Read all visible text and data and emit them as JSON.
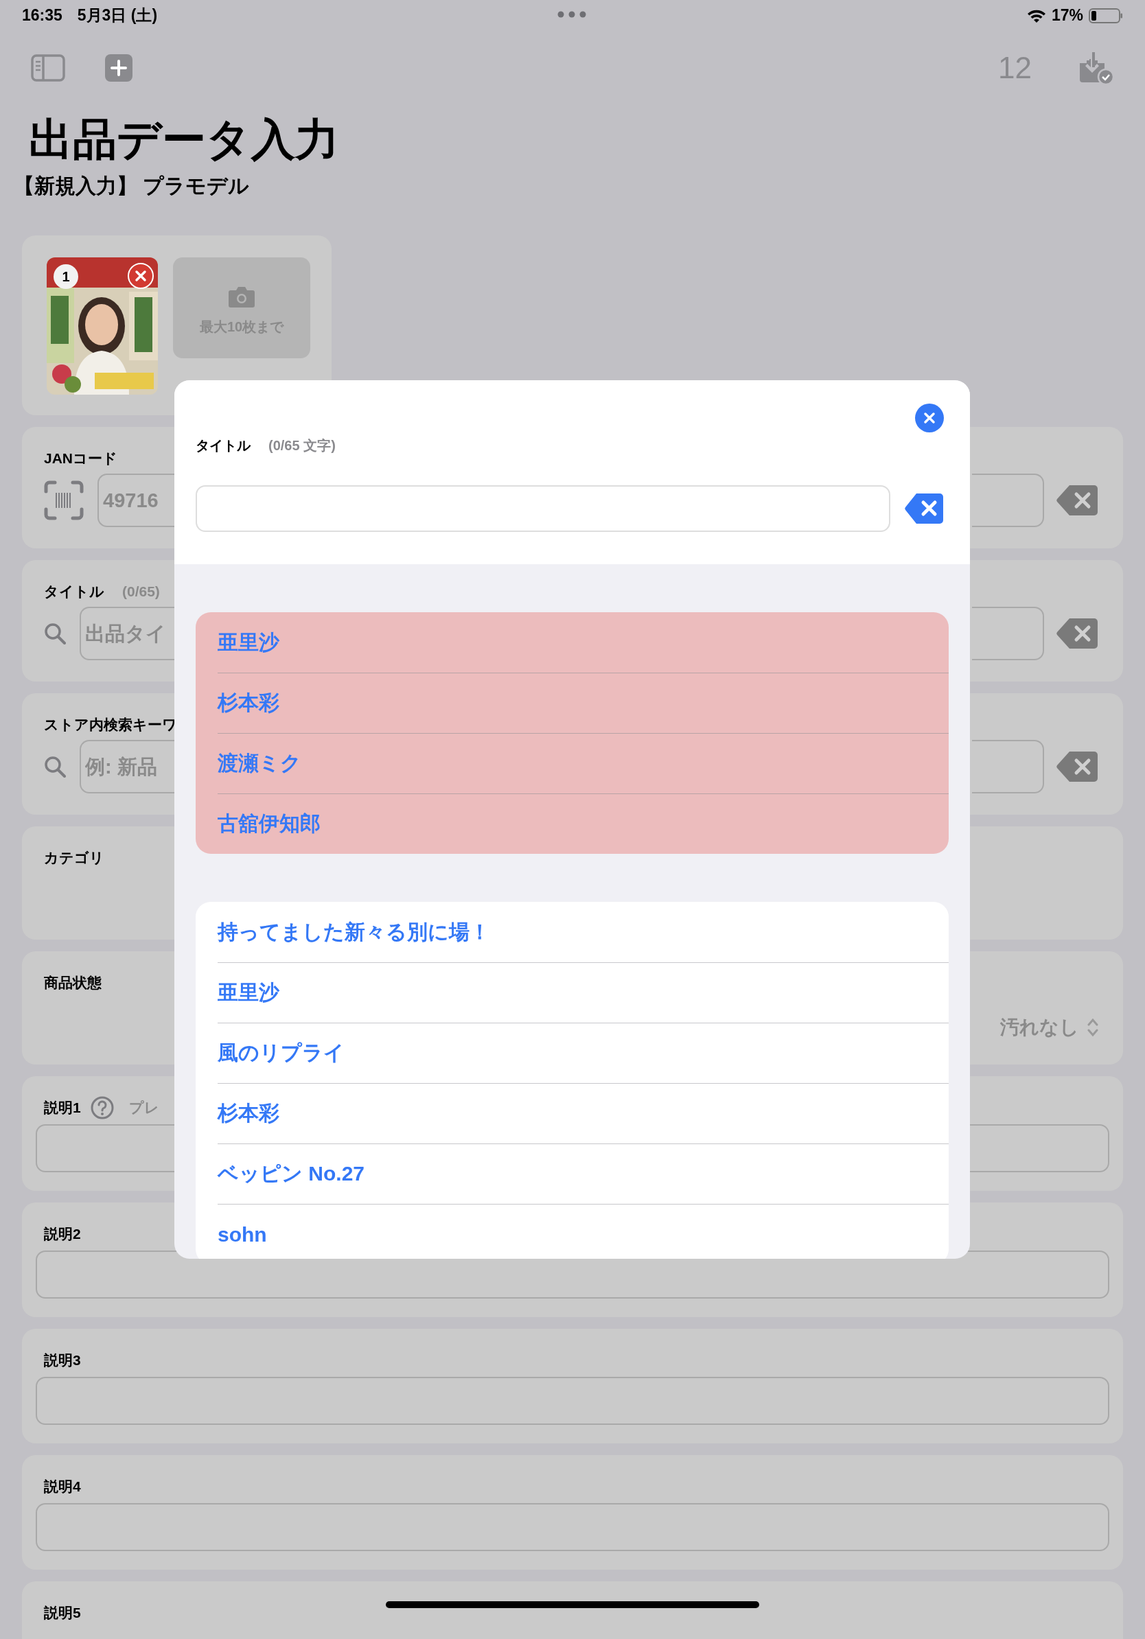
{
  "status_bar": {
    "time": "16:35",
    "date": "5月3日 (土)",
    "battery": "17%"
  },
  "toolbar": {
    "count": "12"
  },
  "header": {
    "title": "出品データ入力",
    "subtitle": "【新規入力】 プラモデル"
  },
  "photos": {
    "items": [
      {
        "kind": "picture",
        "number": "1"
      }
    ],
    "add_hint": "最大10枚まで"
  },
  "form": {
    "fields": [
      {
        "kind": "scan",
        "label": "JANコード",
        "value": "49716"
      },
      {
        "kind": "search",
        "label": "タイトル",
        "counter": "(0/65)",
        "placeholder": "出品タイ"
      },
      {
        "kind": "search",
        "label": "ストア内検索キーワ",
        "placeholder": "例: 新品"
      },
      {
        "kind": "plain",
        "label": "カテゴリ"
      },
      {
        "kind": "picker",
        "label": "商品状態",
        "value": "汚れなし"
      },
      {
        "kind": "text",
        "label": "説明1",
        "help": true,
        "note": "プレ"
      },
      {
        "kind": "text",
        "label": "説明2"
      },
      {
        "kind": "text",
        "label": "説明3"
      },
      {
        "kind": "text",
        "label": "説明4"
      },
      {
        "kind": "plain",
        "label": "説明5"
      }
    ]
  },
  "modal": {
    "label": "タイトル",
    "counter": "(0/65 文字)",
    "recent": [
      "亜里沙",
      "杉本彩",
      "渡瀬ミク",
      "古舘伊知郎"
    ],
    "suggestions": [
      "持ってました新々る別に場！",
      "亜里沙",
      "風のリプライ",
      "杉本彩",
      "ベッピン No.27",
      "sohn"
    ]
  }
}
